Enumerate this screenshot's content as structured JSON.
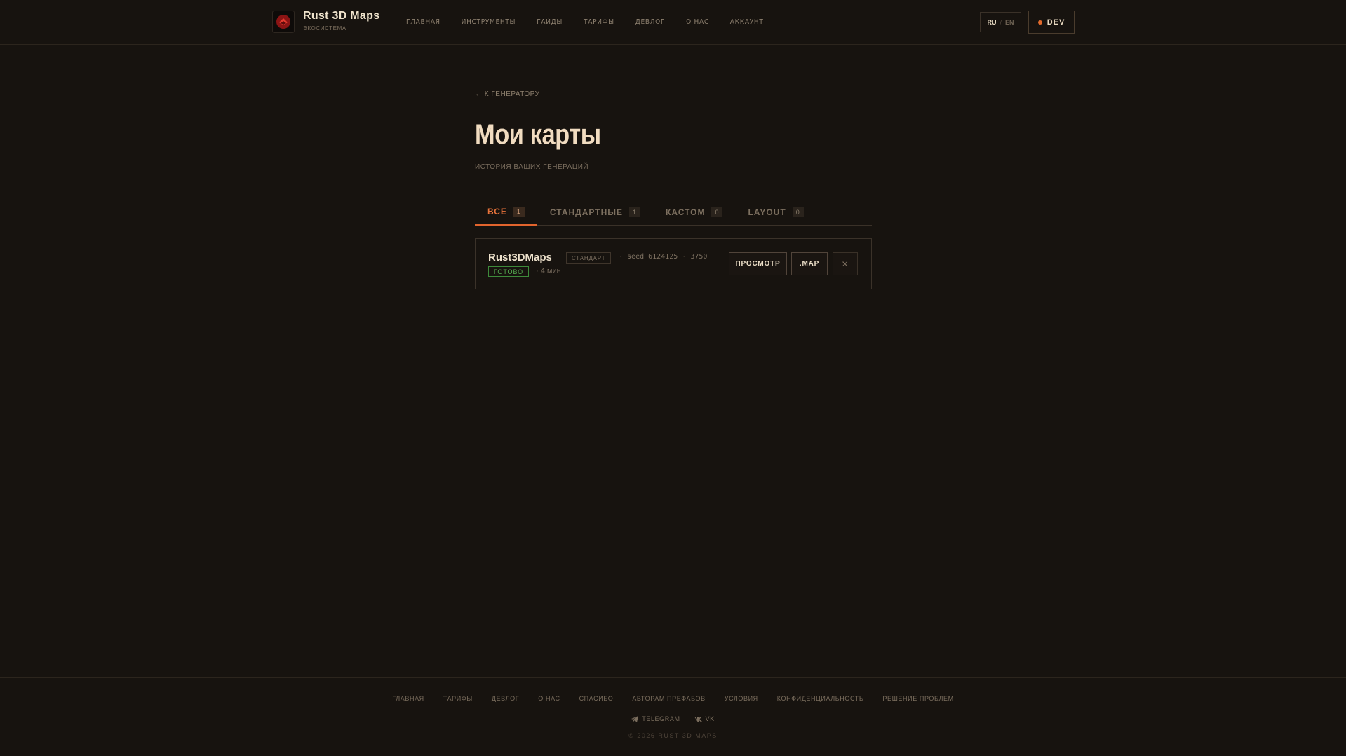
{
  "header": {
    "brand_title": "Rust 3D Maps",
    "brand_sub": "ЭКОСИСТЕМА",
    "nav": [
      "ГЛАВНАЯ",
      "ИНСТРУМЕНТЫ",
      "ГАЙДЫ",
      "ТАРИФЫ",
      "ДЕВЛОГ",
      "О НАС",
      "АККАУНТ"
    ],
    "lang_active": "RU",
    "lang_sep": "/",
    "lang_inactive": "EN",
    "dev_label": "DEV"
  },
  "page": {
    "back_link": "← К ГЕНЕРАТОРУ",
    "title": "Мои карты",
    "subtitle": "ИСТОРИЯ ВАШИХ ГЕНЕРАЦИЙ"
  },
  "tabs": [
    {
      "label": "ВСЕ",
      "count": "1",
      "active": true
    },
    {
      "label": "СТАНДАРТНЫЕ",
      "count": "1",
      "active": false
    },
    {
      "label": "КАСТОМ",
      "count": "0",
      "active": false
    },
    {
      "label": "LAYOUT",
      "count": "0",
      "active": false
    }
  ],
  "map": {
    "name": "Rust3DMaps",
    "type": "СТАНДАРТ",
    "seed": "seed 6124125",
    "size": "3750",
    "status": "ГОТОВО",
    "time": "· 4 мин",
    "view_label": "ПРОСМОТР",
    "map_label": ".MAP",
    "delete_label": "✕"
  },
  "footer": {
    "links": [
      "ГЛАВНАЯ",
      "ТАРИФЫ",
      "ДЕВЛОГ",
      "О НАС",
      "СПАСИБО",
      "АВТОРАМ ПРЕФАБОВ",
      "УСЛОВИЯ",
      "КОНФИДЕНЦИАЛЬНОСТЬ",
      "РЕШЕНИЕ ПРОБЛЕМ"
    ],
    "separator": "·",
    "telegram": "TELEGRAM",
    "vk": "VK",
    "copyright": "© 2026 RUST 3D MAPS"
  },
  "colors": {
    "background": "#17130f",
    "accent": "#e2642d",
    "status_green": "#57b052",
    "title": "#f1dcc0"
  },
  "icons": [
    "logo-icon",
    "telegram-icon",
    "vk-icon",
    "close-icon"
  ]
}
